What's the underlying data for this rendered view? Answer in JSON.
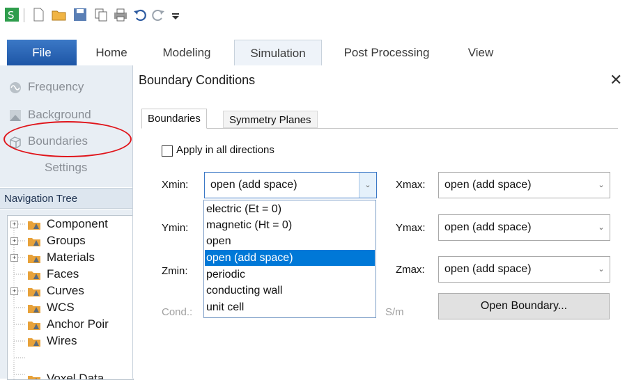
{
  "ribbon": {
    "tabs": [
      "File",
      "Home",
      "Modeling",
      "Simulation",
      "Post Processing",
      "View"
    ],
    "active_tab": "Simulation"
  },
  "left_panel": {
    "items": [
      "Frequency",
      "Background",
      "Boundaries",
      "Settings"
    ],
    "highlighted": "Boundaries"
  },
  "nav_tree": {
    "title": "Navigation Tree",
    "items": [
      "Component",
      "Groups",
      "Materials",
      "Faces",
      "Curves",
      "WCS",
      "Anchor Poir",
      "Wires",
      "Voxel Data"
    ]
  },
  "dialog": {
    "title": "Boundary Conditions",
    "tabs": [
      "Boundaries",
      "Symmetry Planes"
    ],
    "active_tab": "Boundaries",
    "apply_all_label": "Apply in all directions",
    "apply_all_checked": false,
    "xmin_label": "Xmin:",
    "xmin_value": "open (add space)",
    "ymin_label": "Ymin:",
    "zmin_label": "Zmin:",
    "xmax_label": "Xmax:",
    "xmax_value": "open (add space)",
    "ymax_label": "Ymax:",
    "ymax_value": "open (add space)",
    "zmax_label": "Zmax:",
    "zmax_value": "open (add space)",
    "cond_label": "Cond.:",
    "cond_unit": "S/m",
    "open_boundary_button": "Open Boundary...",
    "dropdown_options": [
      "electric (Et = 0)",
      "magnetic (Ht = 0)",
      "open",
      "open (add space)",
      "periodic",
      "conducting wall",
      "unit cell"
    ],
    "dropdown_selected": "open (add space)"
  },
  "colors": {
    "accent": "#0078d7",
    "file_tab": "#2a62b2",
    "annotation": "#e0151b",
    "folder": "#e8a23a"
  }
}
